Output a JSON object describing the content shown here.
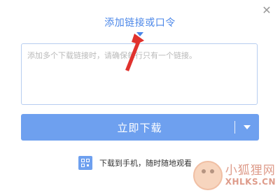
{
  "dialog": {
    "close_icon": "close-icon",
    "title": "添加链接或口令",
    "link_input": {
      "value": "",
      "placeholder": "添加多个下载链接时，请确保每行只有一个链接。"
    },
    "download_button": {
      "label": "立即下载",
      "dropdown_icon": "caret-down-icon"
    },
    "mobile": {
      "icon": "qr-code-icon",
      "label": "下载到手机，随时随地观看"
    }
  },
  "watermark": {
    "cn": "小狐狸网",
    "en": "XHLKS.CN"
  },
  "colors": {
    "accent": "#4a86e8",
    "button": "#6ea0ef",
    "annotation_arrow": "#e0322e"
  }
}
